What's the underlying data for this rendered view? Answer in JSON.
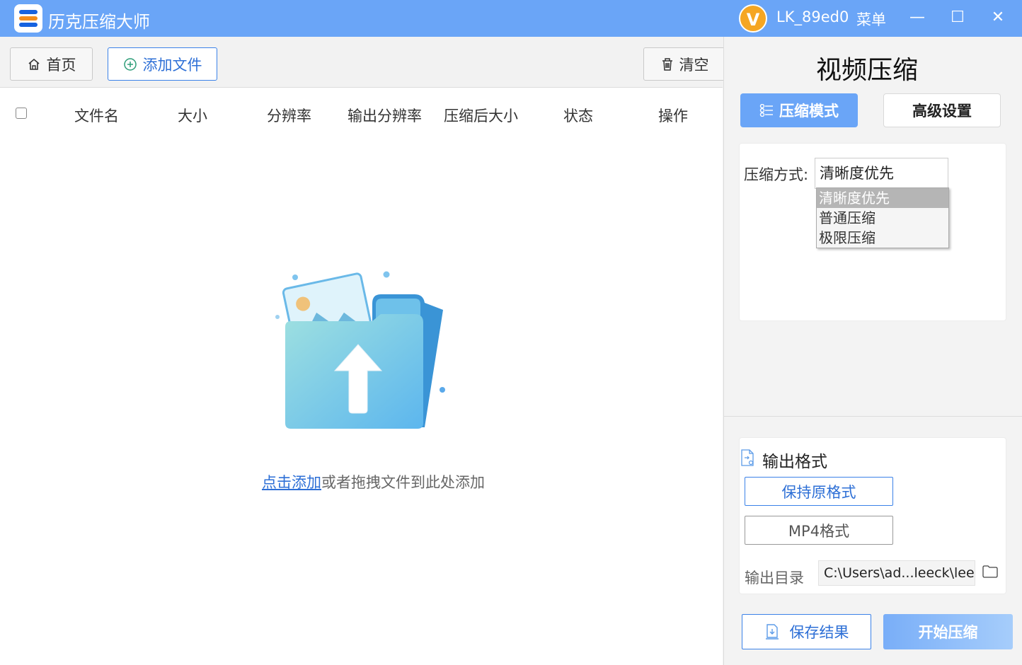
{
  "app": {
    "title": "历克压缩大师",
    "avatar_letter": "V",
    "username": "LK_89ed0",
    "menu_label": "菜单",
    "window_buttons": {
      "minimize": "—",
      "maximize": "☐",
      "close": "✕"
    }
  },
  "toolbar": {
    "home_label": "首页",
    "add_file_label": "添加文件",
    "clear_label": "清空"
  },
  "table": {
    "columns": [
      "文件名",
      "大小",
      "分辨率",
      "输出分辨率",
      "压缩后大小",
      "状态",
      "操作"
    ]
  },
  "dropzone": {
    "link_text": "点击添加",
    "rest_text": "或者拖拽文件到此处添加"
  },
  "panel": {
    "title": "视频压缩",
    "tabs": {
      "compress_mode": "压缩模式",
      "advanced": "高级设置"
    },
    "method_label": "压缩方式:",
    "method_selected": "清晰度优先",
    "method_options": [
      "清晰度优先",
      "普通压缩",
      "极限压缩"
    ],
    "output": {
      "title": "输出格式",
      "keep_format": "保持原格式",
      "mp4_format": "MP4格式",
      "dir_label": "输出目录",
      "dir_value": "C:\\Users\\ad...leeck\\leeck"
    },
    "save_result": "保存结果",
    "start_compress": "开始压缩"
  },
  "colors": {
    "titlebar": "#6aa5f7",
    "accent_blue": "#2d6fd6",
    "avatar": "#f5a623",
    "start_button": "#79aef8"
  }
}
